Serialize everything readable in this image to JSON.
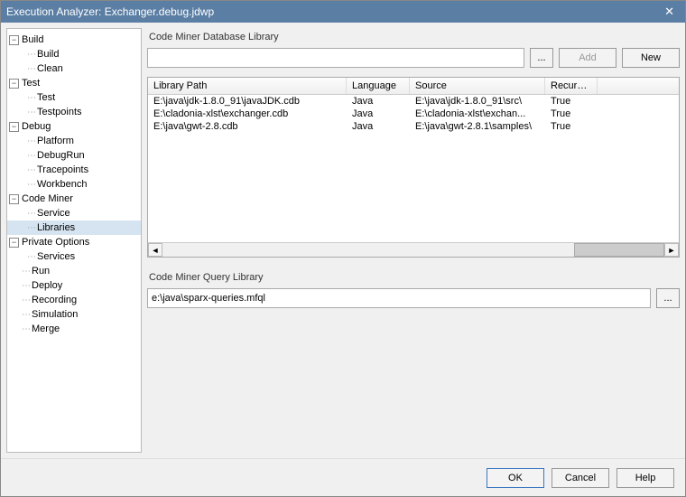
{
  "title": "Execution Analyzer: Exchanger.debug.jdwp",
  "tree": [
    {
      "label": "Build",
      "expanded": true,
      "children": [
        {
          "label": "Build"
        },
        {
          "label": "Clean"
        }
      ]
    },
    {
      "label": "Test",
      "expanded": true,
      "children": [
        {
          "label": "Test"
        },
        {
          "label": "Testpoints"
        }
      ]
    },
    {
      "label": "Debug",
      "expanded": true,
      "children": [
        {
          "label": "Platform"
        },
        {
          "label": "DebugRun"
        },
        {
          "label": "Tracepoints"
        },
        {
          "label": "Workbench"
        }
      ]
    },
    {
      "label": "Code Miner",
      "expanded": true,
      "children": [
        {
          "label": "Service"
        },
        {
          "label": "Libraries",
          "selected": true
        }
      ]
    },
    {
      "label": "Private Options",
      "expanded": true,
      "children": [
        {
          "label": "Services"
        }
      ]
    },
    {
      "label": "Run"
    },
    {
      "label": "Deploy"
    },
    {
      "label": "Recording"
    },
    {
      "label": "Simulation"
    },
    {
      "label": "Merge"
    }
  ],
  "db_section_label": "Code Miner Database Library",
  "db_input_value": "",
  "browse_label": "...",
  "add_label": "Add",
  "new_label": "New",
  "table": {
    "headers": [
      "Library Path",
      "Language",
      "Source",
      "Recursive"
    ],
    "rows": [
      {
        "path": "E:\\java\\jdk-1.8.0_91\\javaJDK.cdb",
        "lang": "Java",
        "src": "E:\\java\\jdk-1.8.0_91\\src\\",
        "rec": "True"
      },
      {
        "path": "E:\\cladonia-xlst\\exchanger.cdb",
        "lang": "Java",
        "src": "E:\\cladonia-xlst\\exchan...",
        "rec": "True"
      },
      {
        "path": "E:\\java\\gwt-2.8.cdb",
        "lang": "Java",
        "src": "E:\\java\\gwt-2.8.1\\samples\\",
        "rec": "True"
      }
    ]
  },
  "query_section_label": "Code Miner Query Library",
  "query_value": "e:\\java\\sparx-queries.mfql",
  "footer": {
    "ok": "OK",
    "cancel": "Cancel",
    "help": "Help"
  }
}
